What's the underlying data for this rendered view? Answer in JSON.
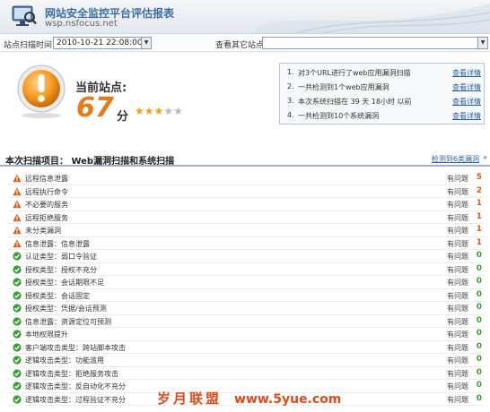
{
  "header": {
    "title": "网站安全监控平台评估报表",
    "subtitle": "wsp.nsfocus.net"
  },
  "toolbar": {
    "scan_time_label": "站点扫描时间",
    "scan_time_value": "2010-10-21 22:08:00",
    "other_site_label": "查看其它站点",
    "other_site_value": " "
  },
  "score_panel": {
    "station_label": "当前站点:",
    "station_value": " ",
    "score": "67",
    "score_unit": "分",
    "stars_total": 5,
    "stars_filled": 3
  },
  "summary": [
    {
      "num": "1.",
      "text": "对3个URL进行了web应用漏洞扫描",
      "link": "查看详情"
    },
    {
      "num": "2.",
      "text": "一共检测到1个web应用漏洞",
      "link": "查看详情"
    },
    {
      "num": "3.",
      "text": "本次系统扫描在 39 天 18小时 以前",
      "link": "查看详情"
    },
    {
      "num": "4.",
      "text": "一共检测到10个系统漏洞",
      "link": "查看详情"
    }
  ],
  "section": {
    "title": "本次扫描项目：  Web漏洞扫描和系统扫描",
    "detected_link": "检测到6类漏洞",
    "chevron": "»"
  },
  "items": [
    {
      "name": "远程信息泄露",
      "status": "有问题",
      "count": "5",
      "level": "warn"
    },
    {
      "name": "远程执行命令",
      "status": "有问题",
      "count": "2",
      "level": "warn"
    },
    {
      "name": "不必要的服务",
      "status": "有问题",
      "count": "1",
      "level": "warn"
    },
    {
      "name": "远程拒绝服务",
      "status": "有问题",
      "count": "1",
      "level": "warn"
    },
    {
      "name": "未分类漏洞",
      "status": "有问题",
      "count": "1",
      "level": "warn"
    },
    {
      "name": "信息泄露：信息泄露",
      "status": "有问题",
      "count": "1",
      "level": "warn"
    },
    {
      "name": "认证类型：弱口令验证",
      "status": "有问题",
      "count": "0",
      "level": "ok"
    },
    {
      "name": "授权类型：授权不充分",
      "status": "有问题",
      "count": "0",
      "level": "ok"
    },
    {
      "name": "授权类型：会话期限不足",
      "status": "有问题",
      "count": "0",
      "level": "ok"
    },
    {
      "name": "授权类型：会话固定",
      "status": "有问题",
      "count": "0",
      "level": "ok"
    },
    {
      "name": "授权类型：凭据/会话预测",
      "status": "有问题",
      "count": "0",
      "level": "ok"
    },
    {
      "name": "信息泄露：资源定位可预测",
      "status": "有问题",
      "count": "0",
      "level": "ok"
    },
    {
      "name": "本地权限提升",
      "status": "有问题",
      "count": "0",
      "level": "ok"
    },
    {
      "name": "客户端攻击类型：跨站脚本攻击",
      "status": "有问题",
      "count": "0",
      "level": "ok"
    },
    {
      "name": "逻辑攻击类型：功能滥用",
      "status": "有问题",
      "count": "0",
      "level": "ok"
    },
    {
      "name": "逻辑攻击类型：拒绝服务攻击",
      "status": "有问题",
      "count": "0",
      "level": "ok"
    },
    {
      "name": "逻辑攻击类型：反自动化不充分",
      "status": "有问题",
      "count": "0",
      "level": "ok"
    },
    {
      "name": "逻辑攻击类型：过程验证不充分",
      "status": "有问题",
      "count": "0",
      "level": "ok"
    }
  ],
  "watermark": {
    "text": "岁月联盟",
    "domain": "www.5yue.com"
  },
  "colors": {
    "accent": "#3e6fa3",
    "warn": "#e05a10",
    "ok": "#3aa036",
    "link": "#2a5fa8",
    "score": "#e87a14"
  }
}
